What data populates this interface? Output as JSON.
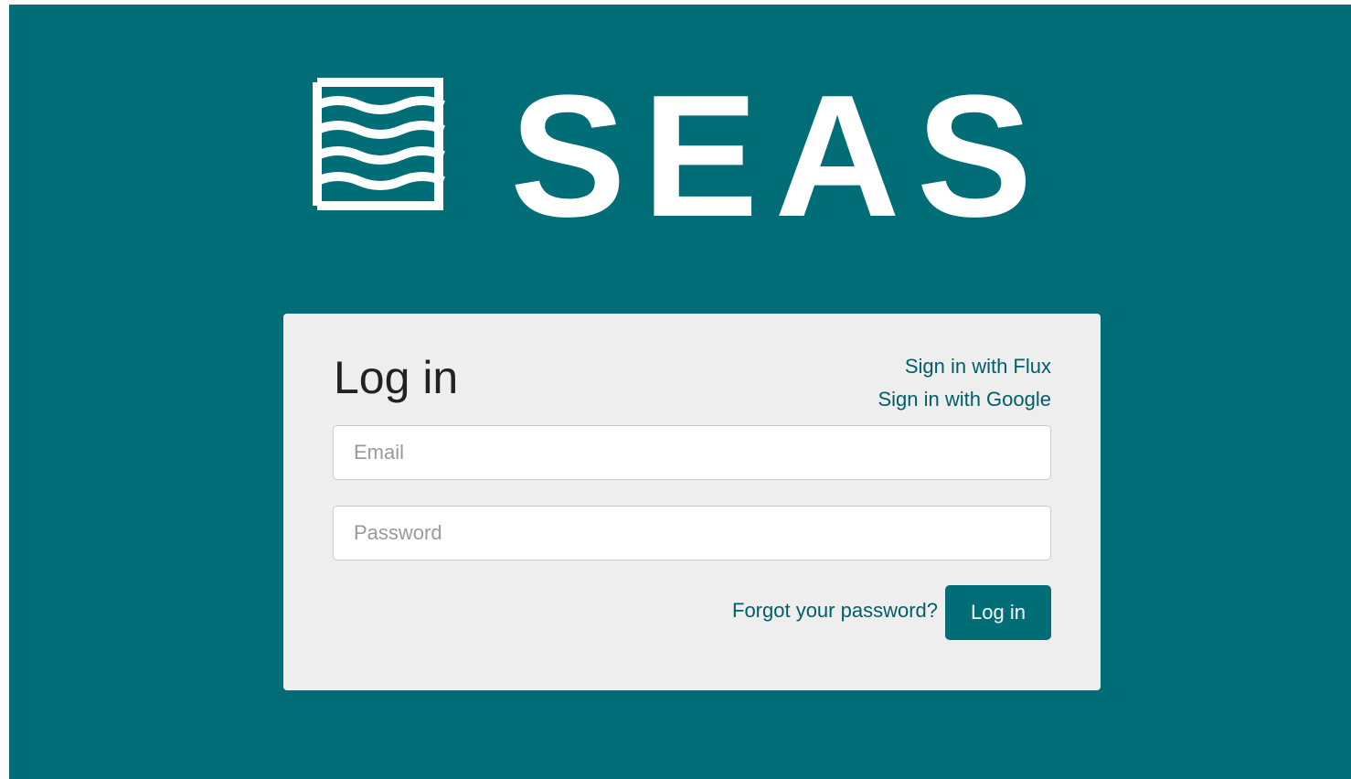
{
  "brand": {
    "name": "SEAS",
    "icon": "seas-wave-icon",
    "colors": {
      "primary": "#006d77",
      "panel": "#eeeeee",
      "text": "#222222",
      "link": "#005e69",
      "white": "#ffffff"
    }
  },
  "login": {
    "title": "Log in",
    "sso": {
      "flux_label": "Sign in with Flux",
      "google_label": "Sign in with Google"
    },
    "email": {
      "placeholder": "Email",
      "value": ""
    },
    "password": {
      "placeholder": "Password",
      "value": ""
    },
    "forgot_label": "Forgot your password?",
    "submit_label": "Log in"
  }
}
